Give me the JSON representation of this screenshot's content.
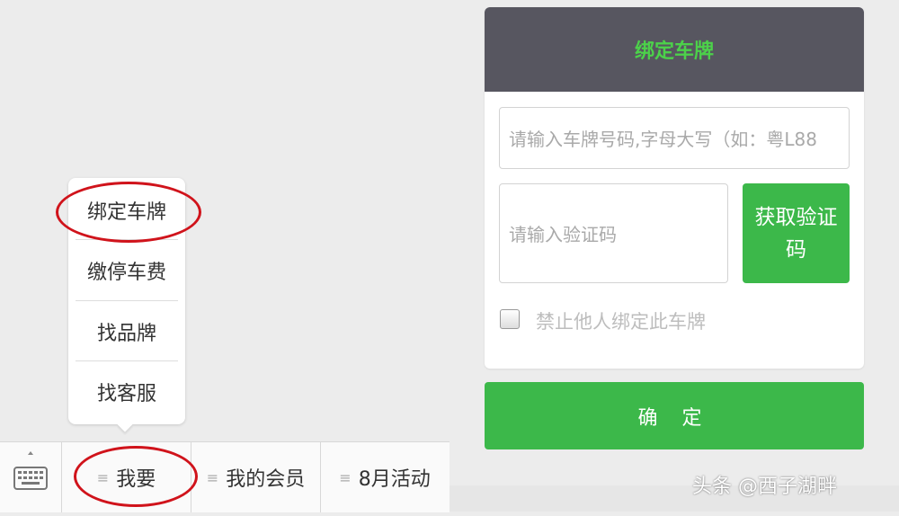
{
  "menu": {
    "items": [
      {
        "label": "绑定车牌"
      },
      {
        "label": "缴停车费"
      },
      {
        "label": "找品牌"
      },
      {
        "label": "找客服"
      }
    ]
  },
  "bottom_bar": {
    "keyboard_icon": "keyboard-icon",
    "tabs": [
      {
        "label": "我要",
        "icon": "menu-lines-icon"
      },
      {
        "label": "我的会员",
        "icon": "menu-lines-icon"
      },
      {
        "label": "8月活动",
        "icon": "menu-lines-icon"
      }
    ]
  },
  "form": {
    "title": "绑定车牌",
    "plate_input": {
      "placeholder": "请输入车牌号码,字母大写（如：粤L88"
    },
    "code_input": {
      "placeholder": "请输入验证码"
    },
    "get_code_button": "获取验证码",
    "checkbox_label": "禁止他人绑定此车牌",
    "confirm_button": "确 定"
  },
  "watermark": "头条 @西子湖畔",
  "colors": {
    "accent_green": "#3cb84a",
    "title_green": "#4cd14a",
    "header_dark": "#575660",
    "highlight_red": "#d0131b"
  }
}
